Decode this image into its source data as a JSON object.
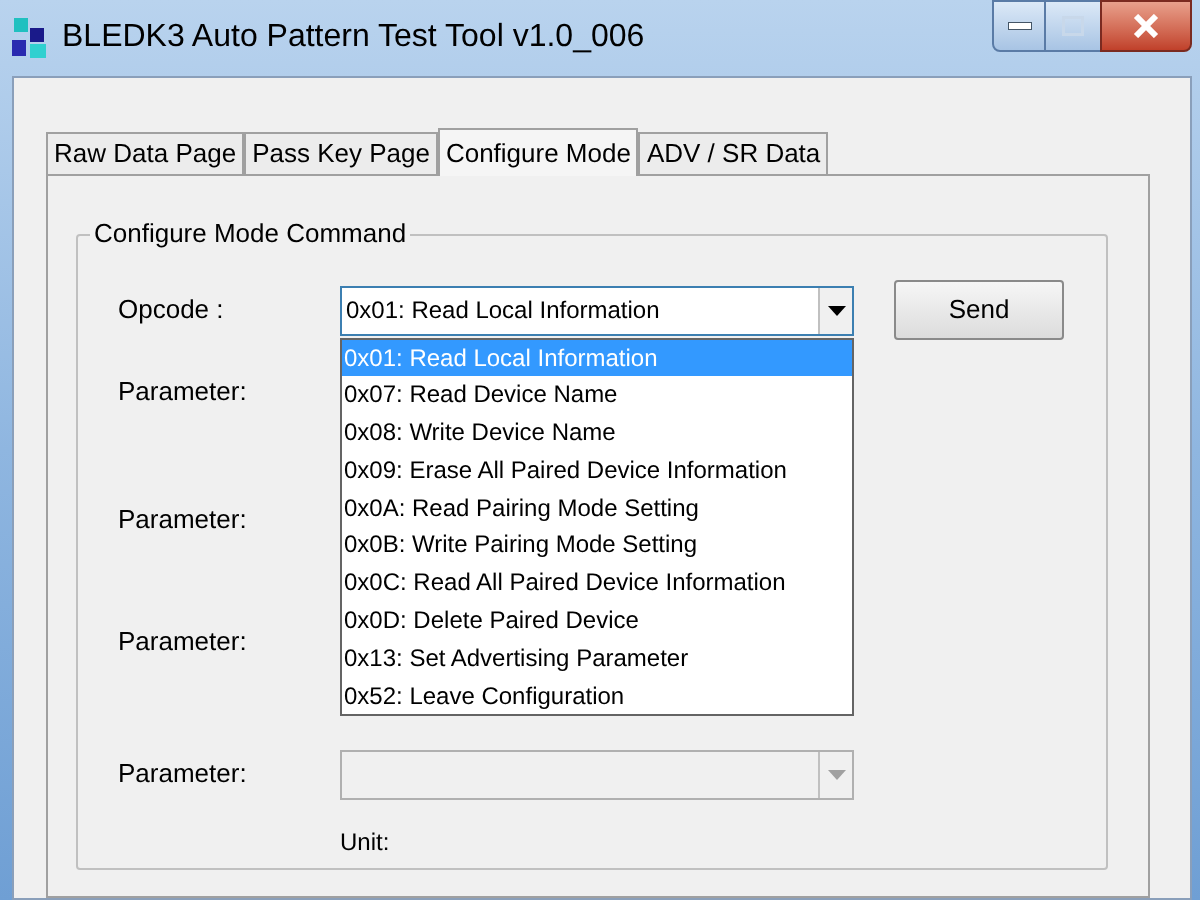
{
  "window": {
    "title": "BLEDK3 Auto Pattern Test Tool v1.0_006"
  },
  "tabs": [
    {
      "label": "Raw Data Page",
      "selected": false
    },
    {
      "label": "Pass Key Page",
      "selected": false
    },
    {
      "label": "Configure Mode",
      "selected": true
    },
    {
      "label": "ADV / SR Data",
      "selected": false
    }
  ],
  "group": {
    "title": "Configure Mode Command"
  },
  "opcode": {
    "label": "Opcode :",
    "value": "0x01: Read Local Information",
    "expanded": true,
    "options": [
      {
        "label": "0x01: Read Local Information",
        "selected": true
      },
      {
        "label": "0x07: Read Device Name",
        "selected": false
      },
      {
        "label": "0x08: Write Device Name",
        "selected": false
      },
      {
        "label": "0x09: Erase All Paired Device Information",
        "selected": false
      },
      {
        "label": "0x0A: Read Pairing Mode Setting",
        "selected": false
      },
      {
        "label": "0x0B: Write Pairing Mode Setting",
        "selected": false
      },
      {
        "label": "0x0C: Read All Paired Device Information",
        "selected": false
      },
      {
        "label": "0x0D: Delete Paired Device",
        "selected": false
      },
      {
        "label": "0x13: Set Advertising Parameter",
        "selected": false
      },
      {
        "label": "0x52: Leave Configuration",
        "selected": false
      }
    ]
  },
  "send_button": "Send",
  "parameters": [
    {
      "label": "Parameter:",
      "kind": "plain"
    },
    {
      "label": "Parameter:",
      "kind": "plain"
    },
    {
      "label": "Parameter:",
      "kind": "plain"
    },
    {
      "label": "Parameter:",
      "kind": "combo",
      "disabled": true,
      "unit": "Unit:"
    }
  ]
}
